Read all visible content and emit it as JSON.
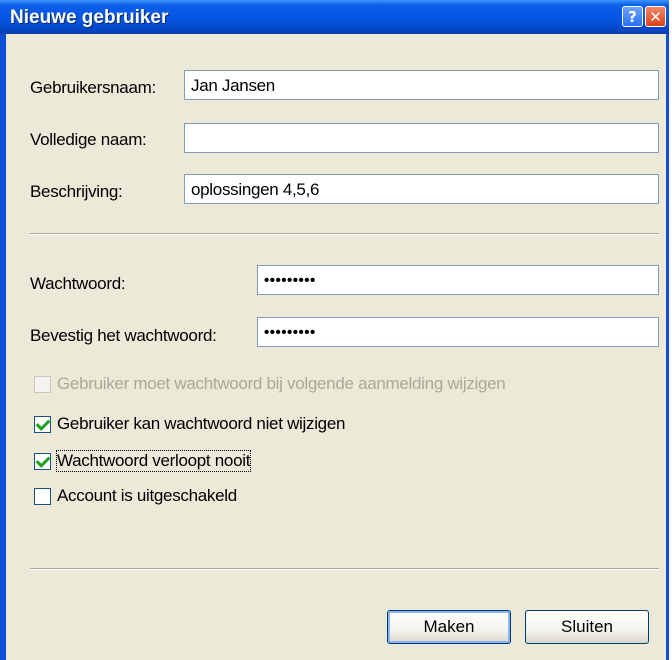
{
  "window": {
    "title": "Nieuwe gebruiker",
    "help_glyph": "?",
    "close_glyph": "✕"
  },
  "form": {
    "username": {
      "label": "Gebruikersnaam:",
      "value": "Jan Jansen"
    },
    "fullname": {
      "label": "Volledige naam:",
      "value": ""
    },
    "description": {
      "label": "Beschrijving:",
      "value": "oplossingen 4,5,6"
    },
    "password": {
      "label": "Wachtwoord:",
      "value": "•••••••••"
    },
    "confirm_password": {
      "label": "Bevestig het wachtwoord:",
      "value": "•••••••••"
    }
  },
  "options": [
    {
      "label": "Gebruiker moet wachtwoord bij volgende aanmelding wijzigen",
      "checked": false,
      "disabled": true
    },
    {
      "label": "Gebruiker kan wachtwoord niet wijzigen",
      "checked": true,
      "disabled": false
    },
    {
      "label": "Wachtwoord verloopt nooit",
      "checked": true,
      "disabled": false,
      "focused": true
    },
    {
      "label": "Account is uitgeschakeld",
      "checked": false,
      "disabled": false
    }
  ],
  "buttons": {
    "create": "Maken",
    "close": "Sluiten"
  },
  "colors": {
    "titlebar": "#0554e3",
    "dialog_bg": "#ece9d8",
    "checkmark": "#21a121",
    "disabled_text": "#aca899"
  }
}
